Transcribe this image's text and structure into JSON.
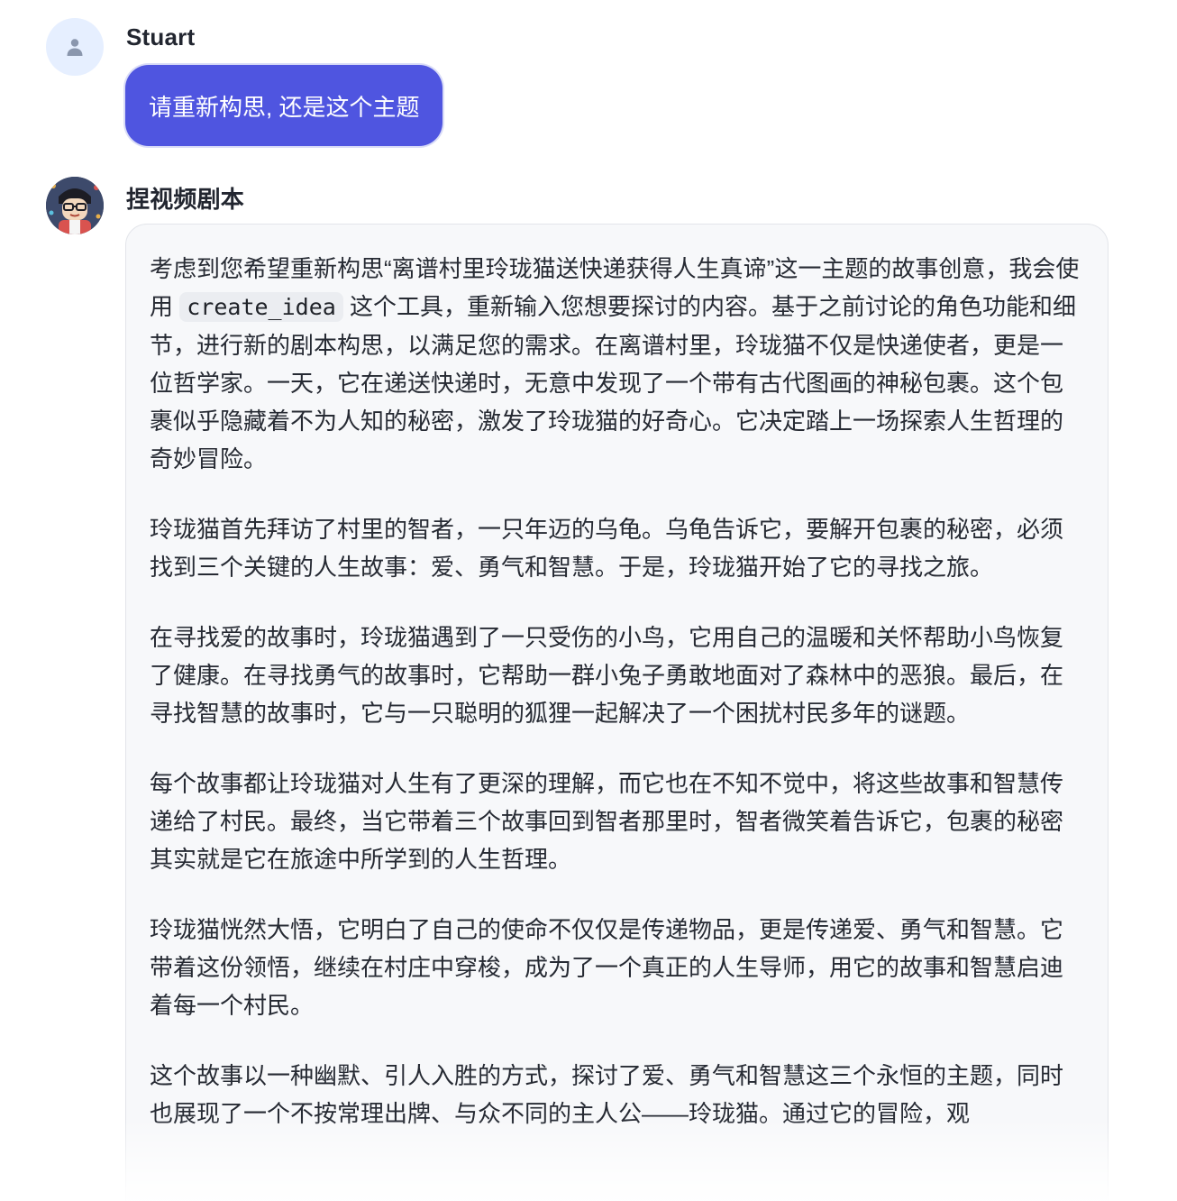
{
  "user_message": {
    "sender": "Stuart",
    "avatar_icon": "user-silhouette-icon",
    "text": "请重新构思, 还是这个主题"
  },
  "bot_message": {
    "sender": "捏视频剧本",
    "avatar_icon": "cartoon-character-avatar",
    "p1_before_code": "考虑到您希望重新构思“离谱村里玲珑猫送快递获得人生真谛”这一主题的故事创意，我会使用 ",
    "p1_code": "create_idea",
    "p1_after_code": " 这个工具，重新输入您想要探讨的内容。基于之前讨论的角色功能和细节，进行新的剧本构思，以满足您的需求。在离谱村里，玲珑猫不仅是快递使者，更是一位哲学家。一天，它在递送快递时，无意中发现了一个带有古代图画的神秘包裹。这个包裹似乎隐藏着不为人知的秘密，激发了玲珑猫的好奇心。它决定踏上一场探索人生哲理的奇妙冒险。",
    "p2": "玲珑猫首先拜访了村里的智者，一只年迈的乌龟。乌龟告诉它，要解开包裹的秘密，必须找到三个关键的人生故事：爱、勇气和智慧。于是，玲珑猫开始了它的寻找之旅。",
    "p3": "在寻找爱的故事时，玲珑猫遇到了一只受伤的小鸟，它用自己的温暖和关怀帮助小鸟恢复了健康。在寻找勇气的故事时，它帮助一群小兔子勇敢地面对了森林中的恶狼。最后，在寻找智慧的故事时，它与一只聪明的狐狸一起解决了一个困扰村民多年的谜题。",
    "p4": "每个故事都让玲珑猫对人生有了更深的理解，而它也在不知不觉中，将这些故事和智慧传递给了村民。最终，当它带着三个故事回到智者那里时，智者微笑着告诉它，包裹的秘密其实就是它在旅途中所学到的人生哲理。",
    "p5": "玲珑猫恍然大悟，它明白了自己的使命不仅仅是传递物品，更是传递爱、勇气和智慧。它带着这份领悟，继续在村庄中穿梭，成为了一个真正的人生导师，用它的故事和智慧启迪着每一个村民。",
    "p6": "这个故事以一种幽默、引人入胜的方式，探讨了爱、勇气和智慧这三个永恒的主题，同时也展现了一个不按常理出牌、与众不同的主人公——玲珑猫。通过它的冒险，观"
  }
}
